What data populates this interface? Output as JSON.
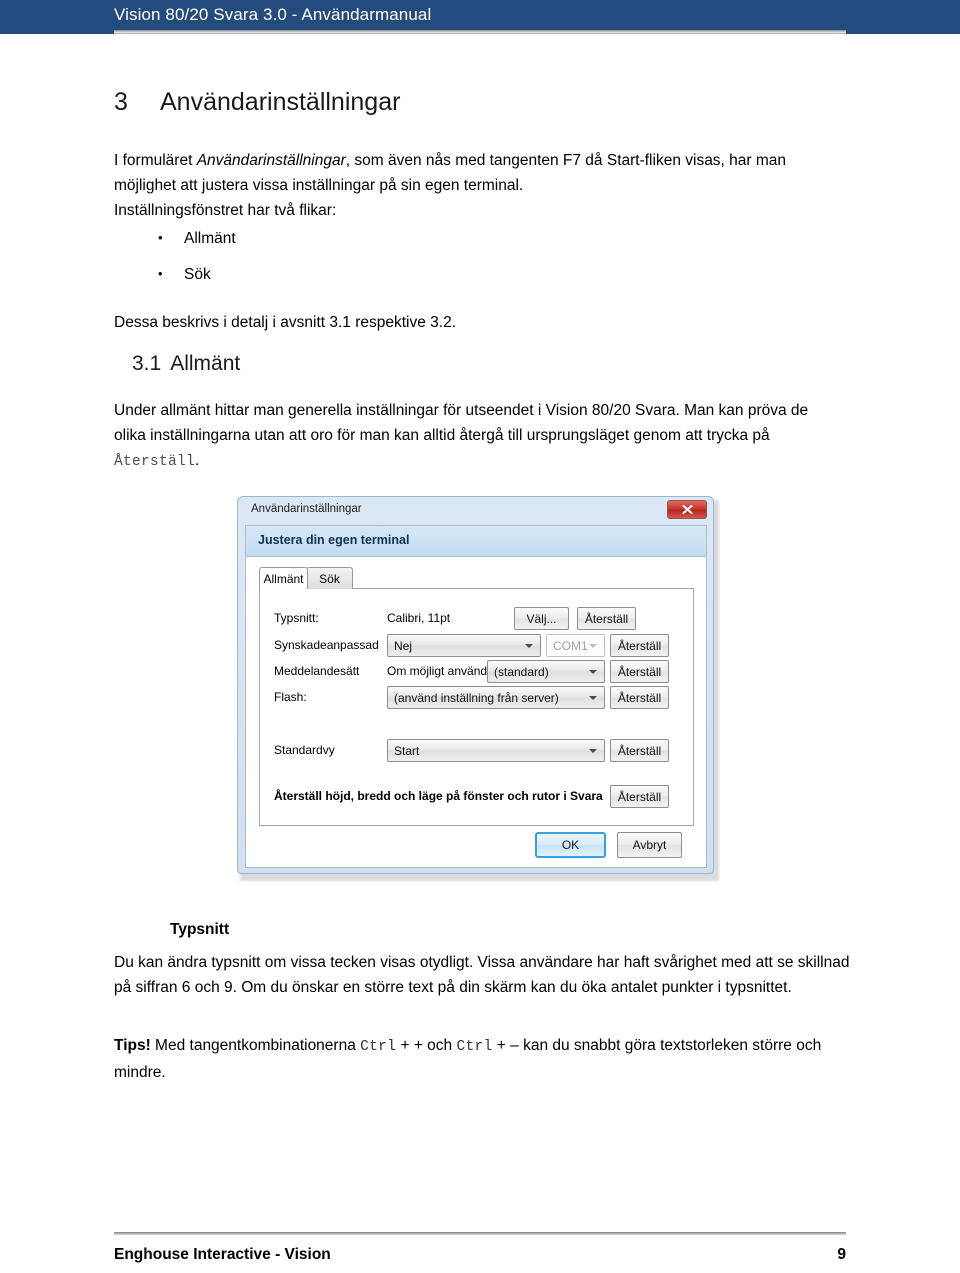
{
  "header": {
    "title": "Vision 80/20 Svara 3.0 - Användarmanual"
  },
  "document": {
    "section_number": "3",
    "section_title": "Användarinställningar",
    "intro_paragraph": "I formuläret Användarinställningar, som även nås med tangenten F7 då Start-fliken visas, har man möjlighet att justera vissa inställningar på sin egen terminal.",
    "intro_italic_term": "Användarinställningar",
    "intro_before_italic": "I formuläret ",
    "intro_after_italic": ", som även nås med tangenten F7 då Start-fliken visas, har man möjlighet att justera vissa inställningar på sin egen terminal.",
    "two_tabs_line": "Inställningsfönstret har två flikar:",
    "bullets": [
      "Allmänt",
      "Sök"
    ],
    "dessa_line": "Dessa beskrivs i detalj i avsnitt 3.1 respektive 3.2.",
    "subsection_number": "3.1",
    "subsection_title": "Allmänt",
    "under_paragraph_part1": "Under allmänt hittar man generella inställningar för utseendet i Vision 80/20 Svara. Man kan pröva de olika inställningarna utan att oro för man kan alltid återgå till ursprungsläget genom att trycka på ",
    "under_paragraph_mono": "Återställ",
    "under_paragraph_part2": ".",
    "typsnitt_heading": "Typsnitt",
    "typsnitt_paragraph": "Du kan ändra typsnitt om vissa tecken visas otydligt. Vissa användare har haft svårighet med att se skillnad på siffran 6 och 9. Om du önskar en större text på din skärm kan du öka antalet punkter i typsnittet.",
    "tips_label": "Tips!",
    "tips_part1": " Med tangentkombinationerna ",
    "tips_mono1": "Ctrl",
    "tips_part2": " + + och ",
    "tips_mono2": "Ctrl",
    "tips_part3": " + – kan du snabbt göra textstorleken större och mindre."
  },
  "dialog": {
    "window_title": "Användarinställningar",
    "close_label": "Stäng",
    "banner_title": "Justera din egen terminal",
    "tabs": [
      {
        "label": "Allmänt",
        "active": true
      },
      {
        "label": "Sök",
        "active": false
      }
    ],
    "rows": [
      {
        "label": "Typsnitt:",
        "static_value": "Calibri, 11pt",
        "choose_button": "Välj...",
        "reset_button": "Återställ"
      },
      {
        "label": "Synskadeanpassad",
        "combo_value": "Nej",
        "port_value": "COM1",
        "reset_button": "Återställ"
      },
      {
        "label": "Meddelandesätt",
        "static_value": "Om möjligt använd",
        "combo_value": "(standard)",
        "reset_button": "Återställ"
      },
      {
        "label": "Flash:",
        "combo_value": "(använd inställning från server)",
        "reset_button": "Återställ"
      },
      {
        "label": "Standardvy",
        "combo_value": "Start",
        "reset_button": "Återställ"
      }
    ],
    "reset_layout_text": "Återställ höjd, bredd och läge på fönster och rutor i Svara",
    "reset_layout_button": "Återställ",
    "ok_button": "OK",
    "cancel_button": "Avbryt"
  },
  "footer": {
    "left": "Enghouse Interactive - Vision",
    "page_number": "9"
  },
  "colors": {
    "header_blue": "#234b7c",
    "banner_blue": "#c3dcf2",
    "close_red": "#c5342c",
    "focus_blue": "#3c9fdf"
  }
}
